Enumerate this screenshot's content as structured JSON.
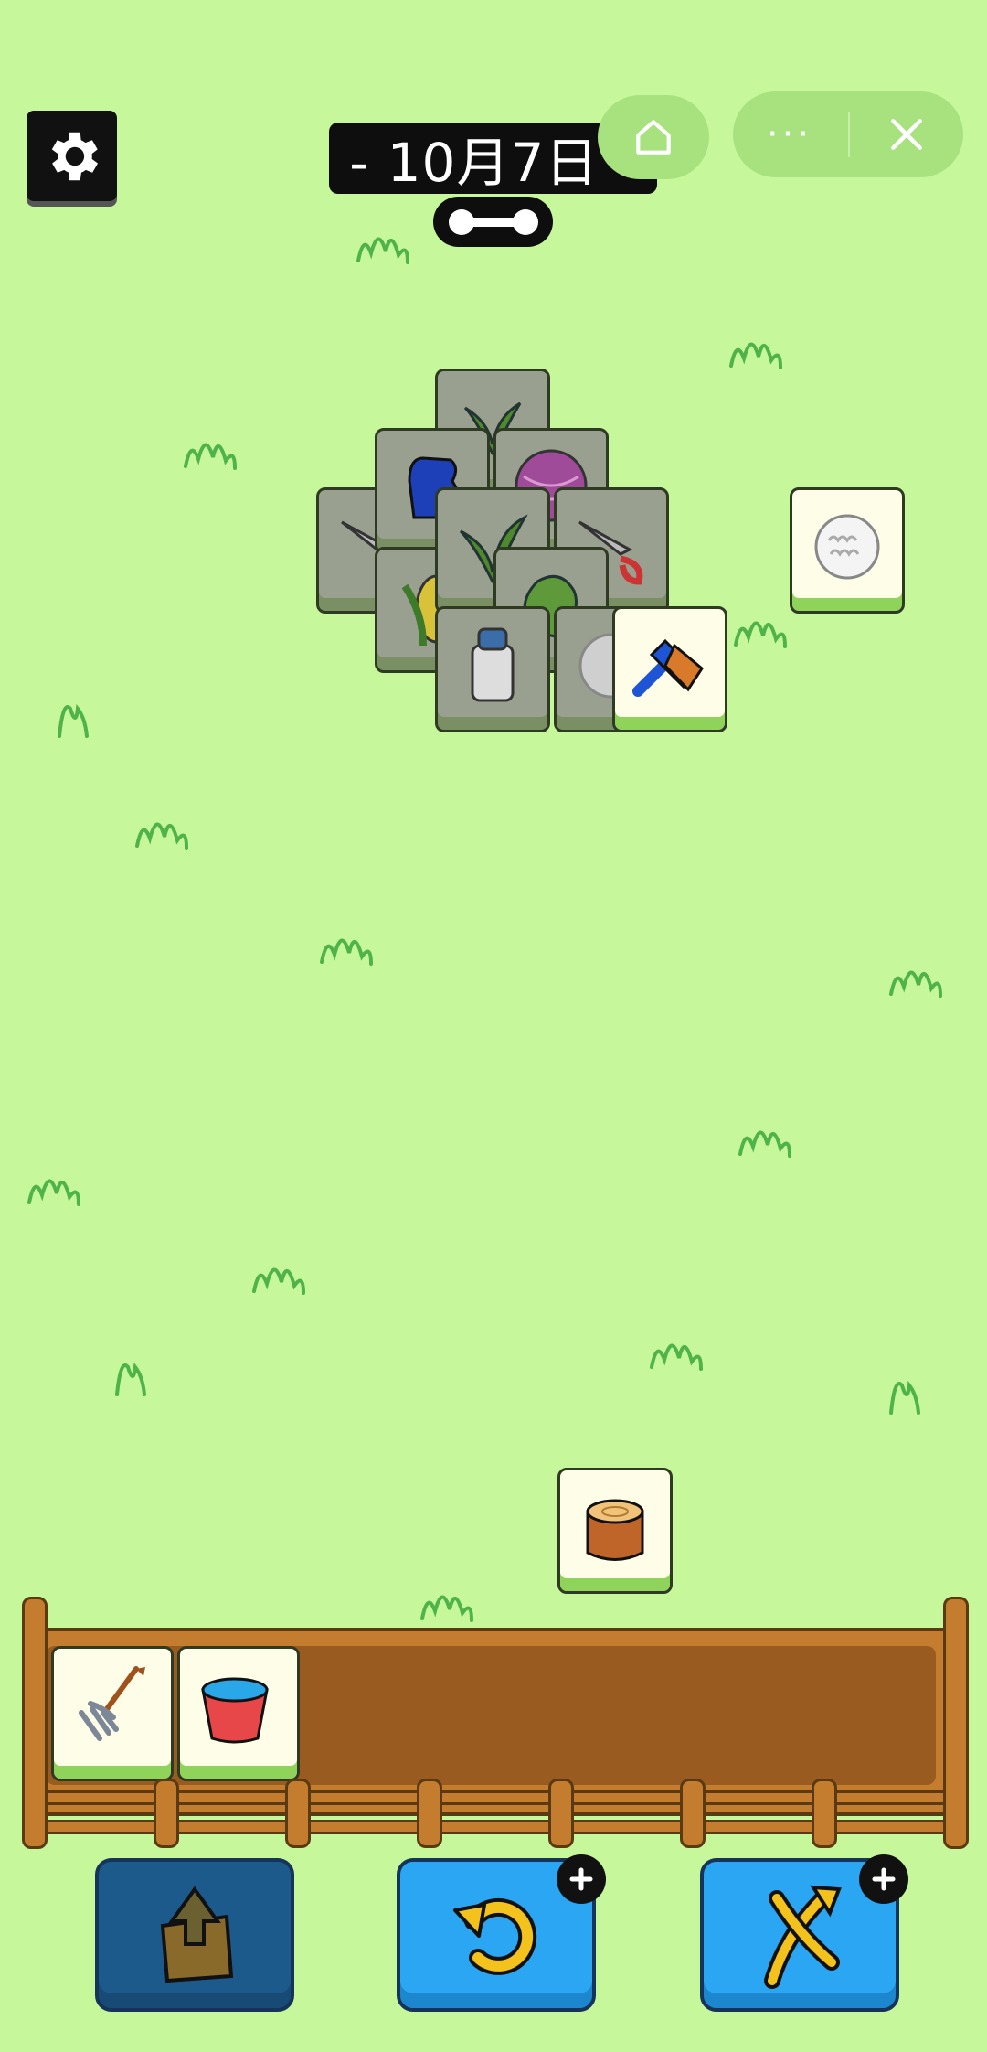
{
  "header": {
    "date_label": "- 10月7日 -",
    "settings_icon": "gear-icon",
    "link_icon": "link-bone-icon",
    "home_icon": "home-icon",
    "more_label": "···",
    "close_icon": "close-icon"
  },
  "board": {
    "stack_tiles": [
      "plant-icon",
      "glove-icon",
      "yarn-ball-icon",
      "shears-icon",
      "shears-icon",
      "corn-icon",
      "plant-icon",
      "cabbage-icon",
      "milk-can-icon",
      "wool-icon",
      "brush-icon"
    ],
    "loose_tiles": [
      "wool-icon",
      "tree-stump-icon"
    ]
  },
  "tray": {
    "slots_filled": [
      "pitchfork-icon",
      "bucket-icon"
    ],
    "capacity": 7
  },
  "toolbar": {
    "buttons": [
      "move-out-icon",
      "undo-icon",
      "shuffle-icon"
    ]
  },
  "colors": {
    "background": "#c6f79a",
    "tile_face": "#fdfde8",
    "tile_base": "#8fd35b",
    "tray_wood": "#c47d2f",
    "button_blue": "#2aa6f2"
  }
}
